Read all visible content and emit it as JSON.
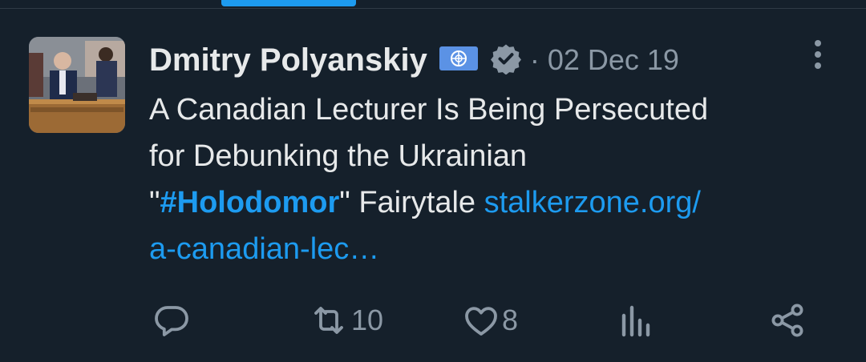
{
  "tweet": {
    "author_name": "Dmitry Polyanskiy",
    "date": "02 Dec 19",
    "date_separator": "·",
    "text_line1": "A Canadian Lecturer Is Being Persecuted",
    "text_line2": "for Debunking the Ukrainian",
    "quote_open": "\"",
    "hashtag": "#Holodomor",
    "quote_close": "\"",
    "text_after": " Fairytale ",
    "link_part1": "stalkerzone.org/",
    "link_part2": "a-canadian-lec…"
  },
  "actions": {
    "reply_count": "",
    "retweet_count": "10",
    "like_count": "8"
  },
  "colors": {
    "background": "#15202b",
    "accent": "#1d9bf0",
    "muted": "#8b98a5",
    "text": "#e7e9ea"
  },
  "icons": [
    "un-flag-icon",
    "verified-badge-icon",
    "more-icon",
    "reply-icon",
    "retweet-icon",
    "like-icon",
    "views-icon",
    "share-icon"
  ]
}
